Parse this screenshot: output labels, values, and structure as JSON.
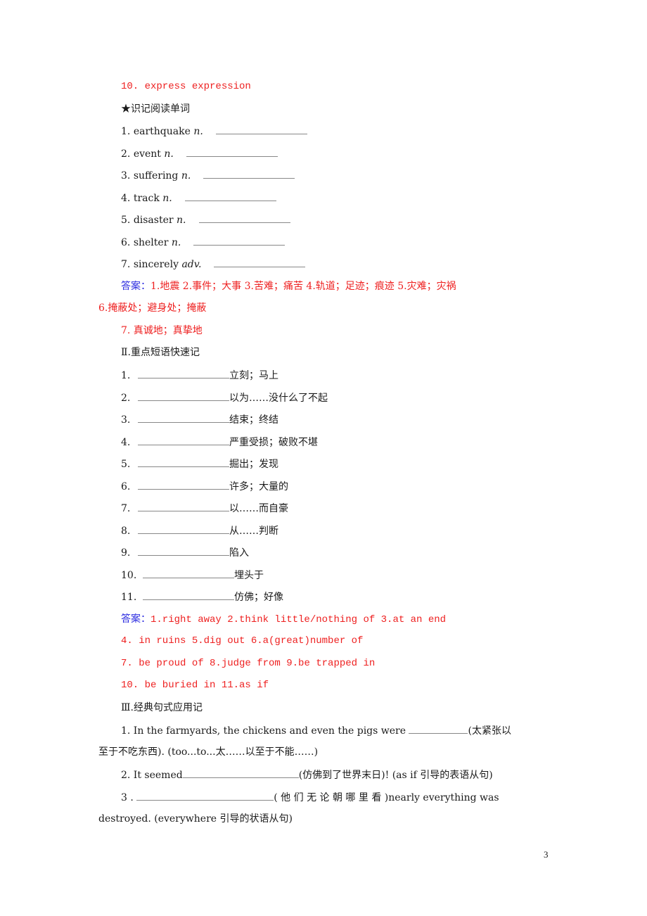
{
  "prev_answer": "10. express  expression",
  "section_reading": {
    "title": "★识记阅读单词",
    "items": [
      {
        "num": "1.",
        "word": "earthquake",
        "pos": "n."
      },
      {
        "num": "2.",
        "word": "event",
        "pos": "n."
      },
      {
        "num": "3.",
        "word": "suffering",
        "pos": "n."
      },
      {
        "num": "4.",
        "word": "track",
        "pos": "n."
      },
      {
        "num": "5.",
        "word": "disaster",
        "pos": "n."
      },
      {
        "num": "6.",
        "word": "shelter",
        "pos": "n."
      },
      {
        "num": "7.",
        "word": "sincerely",
        "pos": "adv."
      }
    ],
    "answer_label": "答案：",
    "answer_lines": [
      "1.地震  2.事件；大事  3.苦难；痛苦  4.轨道；足迹；痕迹  5.灾难；灾祸",
      "6.掩蔽处；避身处；掩蔽",
      "7. 真诚地；真挚地"
    ]
  },
  "section_phrases": {
    "title": "Ⅱ.重点短语快速记",
    "items": [
      {
        "num": "1.",
        "meaning": "立刻；马上"
      },
      {
        "num": "2.",
        "meaning": "以为……没什么了不起"
      },
      {
        "num": "3.",
        "meaning": "结束；终结"
      },
      {
        "num": "4.",
        "meaning": "严重受损；破败不堪"
      },
      {
        "num": "5.",
        "meaning": "掘出；发现"
      },
      {
        "num": "6.",
        "meaning": "许多；大量的"
      },
      {
        "num": "7.",
        "meaning": "以……而自豪"
      },
      {
        "num": "8.",
        "meaning": "从……判断"
      },
      {
        "num": "9.",
        "meaning": "陷入"
      },
      {
        "num": "10.",
        "meaning": "埋头于"
      },
      {
        "num": "11.",
        "meaning": "仿佛；好像"
      }
    ],
    "answer_label": "答案：",
    "answer_lines": [
      "1.right away  2.think little/nothing of  3.at an end",
      "4. in ruins  5.dig out  6.a(great)number of",
      "7. be proud of  8.judge from  9.be trapped in",
      "10. be buried in  11.as if"
    ]
  },
  "section_sentences": {
    "title": "Ⅲ.经典句式应用记",
    "s1_pre": "1. In the farmyards, the chickens and even the pigs were ",
    "s1_post": "(太紧张以",
    "s1_line2": "至于不吃东西). (too...to...太……以至于不能……)",
    "s2_pre": "2. It seemed",
    "s2_post": "(仿佛到了世界末日)! (as if 引导的表语从句)",
    "s3_pre": "3 . ",
    "s3_post": "( 他 们 无 论 朝 哪 里 看 )nearly  everything  was",
    "s3_line2": "destroyed. (everywhere 引导的状语从句)"
  },
  "page_number": "3"
}
